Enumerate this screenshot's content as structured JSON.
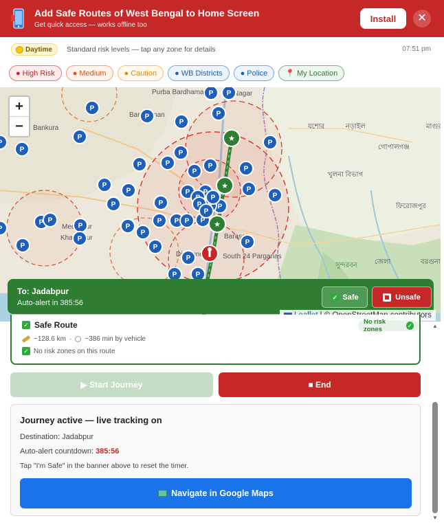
{
  "banner": {
    "title": "Add Safe Routes of West Bengal to Home Screen",
    "subtitle": "Get quick access — works offline too",
    "install_label": "Install",
    "close_label": "✕"
  },
  "status": {
    "mode": "Daytime",
    "text": "Standard risk levels — tap any zone for details",
    "time": "07:51 pm"
  },
  "filters": [
    {
      "label": "High Risk"
    },
    {
      "label": "Medium"
    },
    {
      "label": "Caution"
    },
    {
      "label": "WB Districts"
    },
    {
      "label": "Police"
    },
    {
      "label": "My Location"
    }
  ],
  "map": {
    "zoom_in": "+",
    "zoom_out": "−",
    "attribution_leaflet": "Leaflet",
    "attribution_rest": "| © OpenStreetMap contributors",
    "marker_letter": "P",
    "labels": {
      "purba_bardhaman": "Purba\nBardhaman",
      "bardhaman": "Bardhaman",
      "bankura": "Bankura",
      "medinipur": "Medinipur",
      "kharagpur": "Kharagpur",
      "digha": "Diamond",
      "south24": "South\n24 Parganas",
      "barasat": "Barasat",
      "nagar": "Nagar",
      "jashore": "যশোর",
      "narail": "নড়াইল",
      "magura": "মাগুরা",
      "gopalganj": "গোপালগঞ্জ",
      "khulna": "খুলনা বিভাগ",
      "firozpur": "ফিরোজপুর",
      "barguna": "বরগুনা",
      "sundarban": "সুন্দরবন",
      "jessore2": "জেলা"
    }
  },
  "route_banner": {
    "to": "To: Jadabpur",
    "alert": "Auto-alert in 385:56",
    "safe_label": "Safe",
    "unsafe_label": "Unsafe"
  },
  "route_card": {
    "title": "Safe Route",
    "badge": "No risk zones",
    "distance": "~128.6 km",
    "duration": "~386 min by vehicle",
    "zones": "No risk zones on this route"
  },
  "actions": {
    "start_label": "▶ Start Journey",
    "end_label": "■ End"
  },
  "journey": {
    "title": "Journey active — live tracking on",
    "destination_label": "Destination: Jadabpur",
    "countdown_label": "Auto-alert countdown: ",
    "countdown_value": "385:56",
    "hint": "Tap \"I'm Safe\" in the banner above to reset the timer.",
    "nav_label": "Navigate in Google Maps"
  },
  "colors": {
    "danger": "#c62828",
    "safe": "#2e7d32",
    "primary": "#1a73e8"
  }
}
